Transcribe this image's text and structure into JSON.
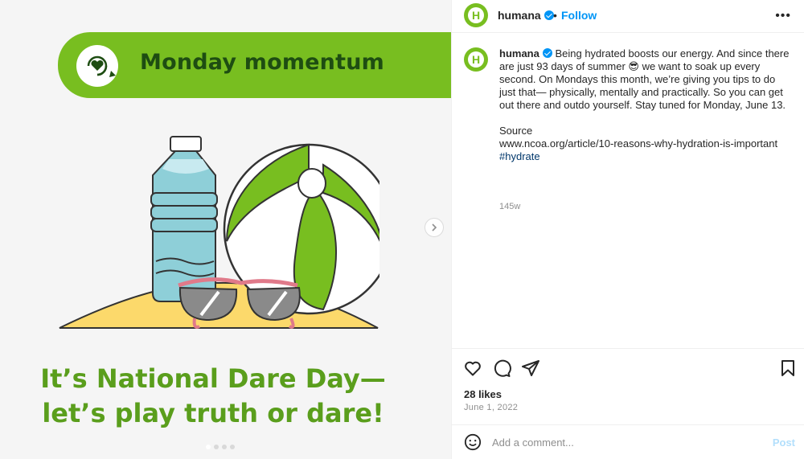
{
  "colors": {
    "brand_green": "#78be20",
    "banner_text": "#1e4d12",
    "caption_green": "#5a9e1c",
    "link_blue": "#0095f6",
    "hashtag_blue": "#00376b",
    "muted_gray": "#8e8e8e"
  },
  "media": {
    "banner_title": "Monday momentum",
    "caption_line1": "It’s National Dare Day—",
    "caption_line2": "let’s play truth or dare!",
    "carousel_total": 4,
    "carousel_active": 1
  },
  "header": {
    "username": "humana",
    "separator": "•",
    "follow_label": "Follow",
    "more_label": "•••",
    "avatar_letter": "H"
  },
  "comment": {
    "username": "humana",
    "text": "Being hydrated boosts our energy. And since there are just 93 days of summer 😎 we want to soak up every second. On Mondays this month, we’re giving you tips to do just that— physically, mentally and practically. So you can get out there and outdo yourself. Stay tuned for Monday, June 13.",
    "source_label": "Source",
    "source_url": "www.ncoa.org/article/10-reasons-why-hydration-is-important",
    "hashtag": "#hydrate",
    "time_ago": "145w"
  },
  "actions": {
    "icons": [
      "heart-icon",
      "comment-icon",
      "share-icon",
      "bookmark-icon"
    ]
  },
  "stats": {
    "likes": "28 likes",
    "date": "June 1, 2022"
  },
  "add_comment": {
    "placeholder": "Add a comment...",
    "post_label": "Post"
  }
}
